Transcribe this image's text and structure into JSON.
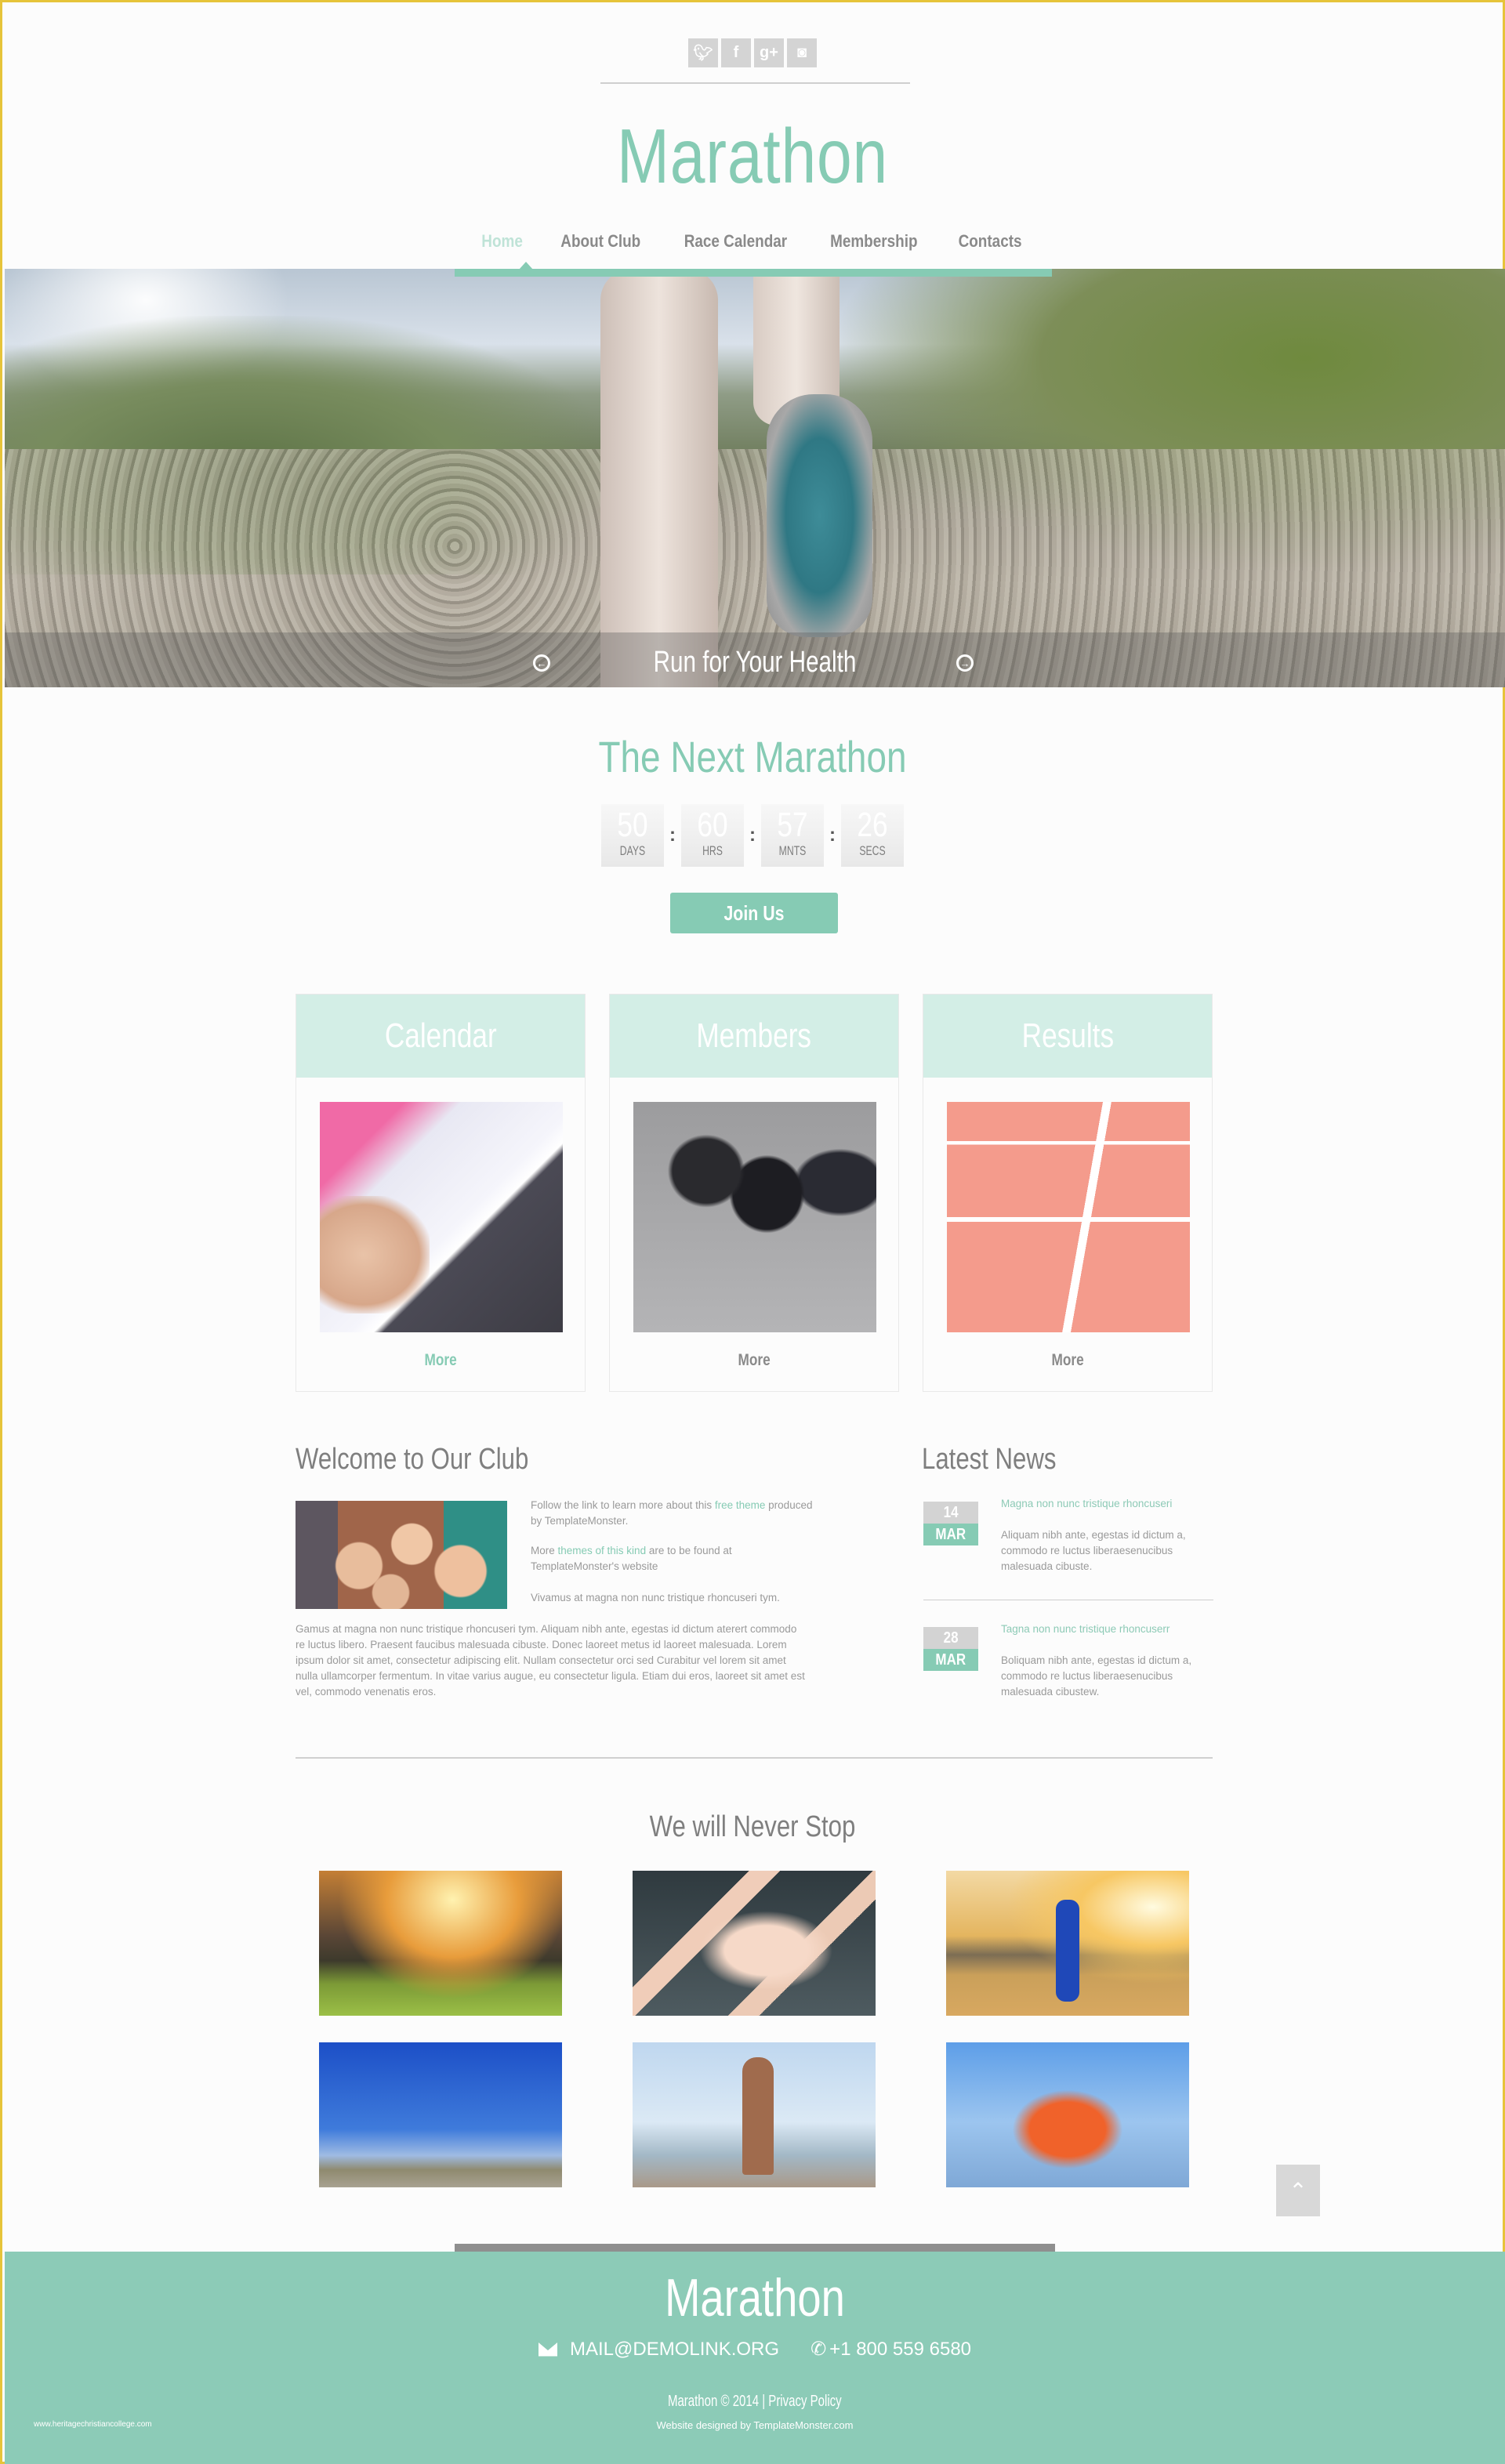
{
  "header": {
    "social": [
      {
        "name": "twitter",
        "glyph": "🐦︎"
      },
      {
        "name": "facebook",
        "glyph": "f"
      },
      {
        "name": "google-plus",
        "glyph": "g+"
      },
      {
        "name": "instagram",
        "glyph": "◙"
      }
    ],
    "logo": "Marathon",
    "nav": [
      {
        "label": "Home",
        "active": true
      },
      {
        "label": "About Club",
        "active": false
      },
      {
        "label": "Race Calendar",
        "active": false
      },
      {
        "label": "Membership",
        "active": false
      },
      {
        "label": "Contacts",
        "active": false
      }
    ]
  },
  "hero": {
    "caption": "Run for Your Health",
    "prev_glyph": "←",
    "next_glyph": "→"
  },
  "countdown": {
    "title": "The Next Marathon",
    "units": [
      {
        "value": "50",
        "label": "DAYS"
      },
      {
        "value": "60",
        "label": "HRS"
      },
      {
        "value": "57",
        "label": "MNTS"
      },
      {
        "value": "26",
        "label": "SECS"
      }
    ],
    "separator": ":",
    "button": "Join Us"
  },
  "cards": [
    {
      "title": "Calendar",
      "more": "More"
    },
    {
      "title": "Members",
      "more": "More"
    },
    {
      "title": "Results",
      "more": "More"
    }
  ],
  "welcome": {
    "title": "Welcome to Our Club",
    "p1_prefix": "Follow the link to learn more about this ",
    "p1_link": "free theme",
    "p1_suffix": " produced by TemplateMonster.",
    "p2_prefix": "More ",
    "p2_link": "themes of this kind",
    "p2_suffix": " are to be found at TemplateMonster's website",
    "p3": "Vivamus at magna non nunc tristique rhoncuseri tym.",
    "body": "Gamus at magna non nunc tristique rhoncuseri tym. Aliquam nibh ante, egestas id dictum aterert commodo re luctus libero. Praesent faucibus malesuada cibuste. Donec laoreet metus id laoreet malesuada. Lorem ipsum dolor sit amet, consectetur adipiscing elit. Nullam consectetur orci sed Curabitur vel lorem sit amet nulla ullamcorper fermentum. In vitae varius augue, eu consectetur ligula. Etiam dui eros, laoreet sit amet est vel, commodo venenatis eros."
  },
  "news": {
    "title": "Latest News",
    "items": [
      {
        "day": "14",
        "month": "MAR",
        "headline": "Magna non nunc tristique rhoncuseri",
        "body": "Aliquam nibh ante, egestas id dictum a, commodo re luctus liberaesenucibus malesuada cibuste."
      },
      {
        "day": "28",
        "month": "MAR",
        "headline": "Tagna non nunc tristique rhoncuserr",
        "body": "Boliquam nibh ante, egestas id dictum a, commodo re luctus liberaesenucibus malesuada cibustew."
      }
    ]
  },
  "gallery": {
    "title": "We will Never Stop"
  },
  "back_to_top": "⌃",
  "footer": {
    "logo": "Marathon",
    "email": "MAIL@DEMOLINK.ORG",
    "phone": "+1 800 559 6580",
    "phone_glyph": "✆",
    "copyright": "Marathon © 2014 | Privacy Policy",
    "designed_by": "Website designed by TemplateMonster.com",
    "watermark": "www.heritagechristiancollege.com"
  },
  "colors": {
    "accent": "#86cbb4",
    "accent_light": "#d3eee6",
    "text_gray": "#8a8a8a",
    "footer_bg": "#8ccbb7",
    "frame_border": "#e6c43a"
  }
}
